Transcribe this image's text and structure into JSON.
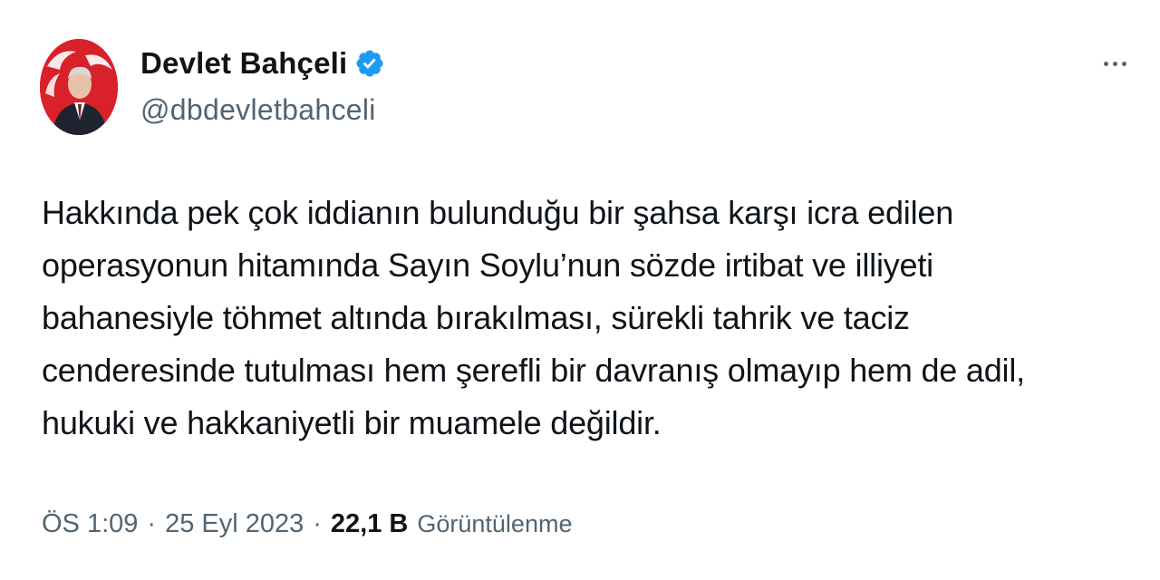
{
  "author": {
    "display_name": "Devlet Bahçeli",
    "handle": "@dbdevletbahceli",
    "verified": true,
    "verified_color": "#1d9bf0",
    "avatar_icon": "profile-photo"
  },
  "menu": {
    "icon": "more-horizontal-icon"
  },
  "tweet": {
    "text": "Hakkında pek çok iddianın bulunduğu bir şahsa karşı icra edilen\noperasyonun hitamında Sayın Soylu’nun sözde irtibat ve illiyeti\nbahanesiyle töhmet altında bırakılması, sürekli tahrik ve taciz\ncenderesinde tutulması hem şerefli bir davranış olmayıp hem de adil,\nhukuki ve hakkaniyetli bir muamele değildir."
  },
  "meta": {
    "time": "ÖS 1:09",
    "separator": "·",
    "date": "25 Eyl 2023",
    "views_count": "22,1 B",
    "views_label": "Görüntülenme"
  },
  "colors": {
    "text_primary": "#0f1419",
    "text_secondary": "#536471",
    "avatar_bg": "#d9212a"
  }
}
